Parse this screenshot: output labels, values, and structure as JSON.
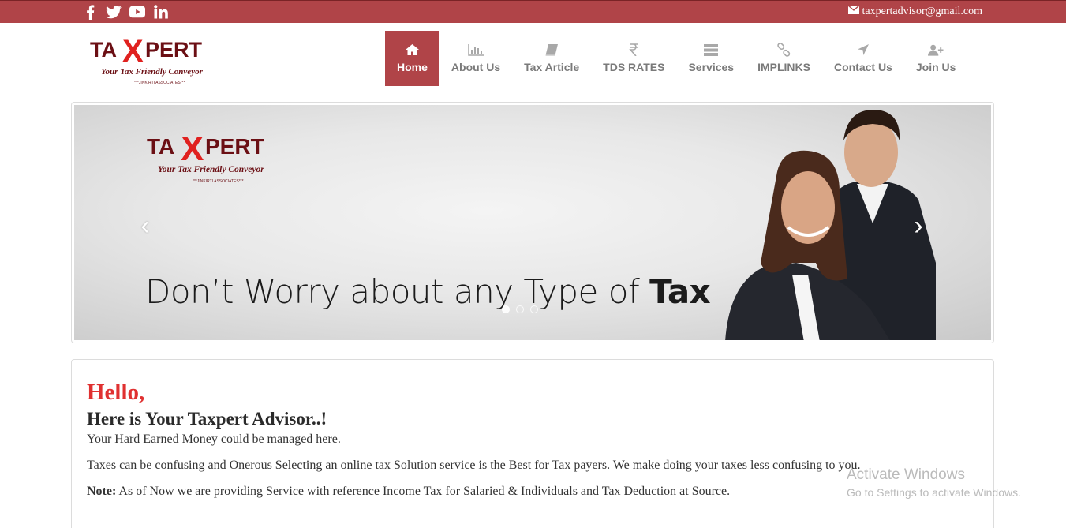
{
  "topbar": {
    "social_icons": [
      "facebook-icon",
      "twitter-icon",
      "youtube-icon",
      "linkedin-icon"
    ],
    "email": "taxpertadvisor@gmail.com",
    "bg_color": "#b04448"
  },
  "logo": {
    "brand": "TAXPERT",
    "tagline": "Your Tax Friendly Conveyor",
    "small": "***JINKIRTI ASSOCIATES***"
  },
  "nav": {
    "items": [
      {
        "label": "Home",
        "icon": "home-icon",
        "active": true
      },
      {
        "label": "About Us",
        "icon": "bar-chart-icon"
      },
      {
        "label": "Tax Article",
        "icon": "book-icon"
      },
      {
        "label": "TDS RATES",
        "icon": "rupee-icon"
      },
      {
        "label": "Services",
        "icon": "server-icon"
      },
      {
        "label": "IMPLINKS",
        "icon": "link-icon"
      },
      {
        "label": "Contact Us",
        "icon": "location-arrow-icon"
      },
      {
        "label": "Join Us",
        "icon": "user-plus-icon"
      }
    ]
  },
  "carousel": {
    "tagline_prefix": "Don’t Worry about any Type of ",
    "tagline_bold": "Tax",
    "prev": "‹",
    "next": "›",
    "slide_count": 3,
    "active_slide": 1
  },
  "content": {
    "hello": "Hello,",
    "subheading": "Here is Your Taxpert Advisor..!",
    "line1": "Your Hard Earned Money could be managed here.",
    "line2": "Taxes can be confusing and Onerous Selecting an online tax Solution service is the Best for Tax payers. We make doing your taxes less confusing to you.",
    "note_label": "Note:",
    "note_text": " As of Now we are providing Service with reference Income Tax for Salaried & Individuals and Tax Deduction at Source."
  },
  "watermark": {
    "line1": "Activate Windows",
    "line2": "Go to Settings to activate Windows."
  },
  "colors": {
    "accent": "#b04448",
    "hello": "#e03131",
    "logo_red": "#e0211f",
    "logo_dark": "#6b0f14"
  }
}
